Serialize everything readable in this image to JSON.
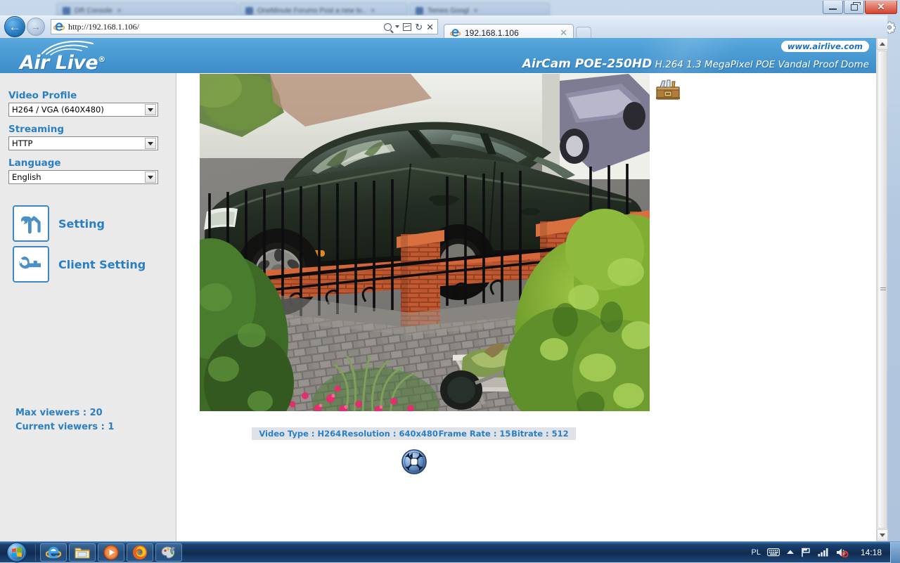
{
  "background_window": {
    "tabs": [
      {
        "title": "DR Console",
        "icon": "page-icon"
      },
      {
        "title": "OneMinute Forums Post a new to..",
        "icon": "page-icon"
      },
      {
        "title": "Temes Googl",
        "icon": "page-icon"
      }
    ],
    "controls": {
      "minimize": "–",
      "restore": "❐",
      "close": "✕"
    },
    "toolbar_icons": [
      "home-icon",
      "favorites-star-icon",
      "tools-gear-icon"
    ]
  },
  "browser": {
    "back_label": "←",
    "forward_label": "→",
    "address": "http://192.168.1.106/",
    "address_icons": [
      "search-icon",
      "dropdown-caret-icon",
      "compatibility-view-icon",
      "refresh-icon",
      "stop-icon"
    ],
    "refresh_glyph": "↻",
    "stop_glyph": "✕",
    "tab": {
      "title": "192.168.1.106",
      "close": "✕"
    }
  },
  "banner": {
    "brand": "Air Live",
    "brand_registered": "®",
    "model": "AirCam POE-250HD",
    "model_desc": "H.264 1.3 MegaPixel POE Vandal Proof Dome",
    "website": "www.airlive.com",
    "bg_color": "#4d9ed6",
    "accent_color": "#2a7fc4"
  },
  "sidebar": {
    "video_profile_label": "Video Profile",
    "video_profile_value": "H264 / VGA (640X480)",
    "streaming_label": "Streaming",
    "streaming_value": "HTTP",
    "language_label": "Language",
    "language_value": "English",
    "setting_button": "Setting",
    "client_setting_button": "Client Setting",
    "max_viewers": "Max viewers : 20",
    "current_viewers": "Current viewers : 1"
  },
  "video": {
    "status": {
      "video_type": "Video Type : H264",
      "resolution": "Resolution : 640x480",
      "frame_rate": "Frame Rate : 15",
      "bitrate": "Bitrate : 512"
    },
    "fullscreen_button_name": "fullscreen-expand-button",
    "overlay_icon_name": "toolbox-icon",
    "scene_description": "Outdoor driveway camera view: dark green sedan parked behind a black wrought-iron fence with red brick pillars, a wheelbarrow of garden clippings, potted plants, pink flowers and a large green shrub on cobblestone paving."
  },
  "taskbar": {
    "start_label": "Start",
    "items": [
      {
        "name": "internet-explorer",
        "glyph": "e"
      },
      {
        "name": "windows-explorer",
        "glyph": "▤"
      },
      {
        "name": "media-player",
        "glyph": "▶"
      },
      {
        "name": "firefox",
        "glyph": "◉"
      },
      {
        "name": "paint",
        "glyph": "✐"
      }
    ],
    "tray": {
      "language": "PL",
      "keyboard_icon": "keyboard-icon",
      "show_hidden_icon": "chevron-up-icon",
      "network_flag_icon": "flag-icon",
      "signal_icon": "signal-bars-icon",
      "volume_icon": "volume-muted-icon",
      "clock": "14:18"
    }
  }
}
